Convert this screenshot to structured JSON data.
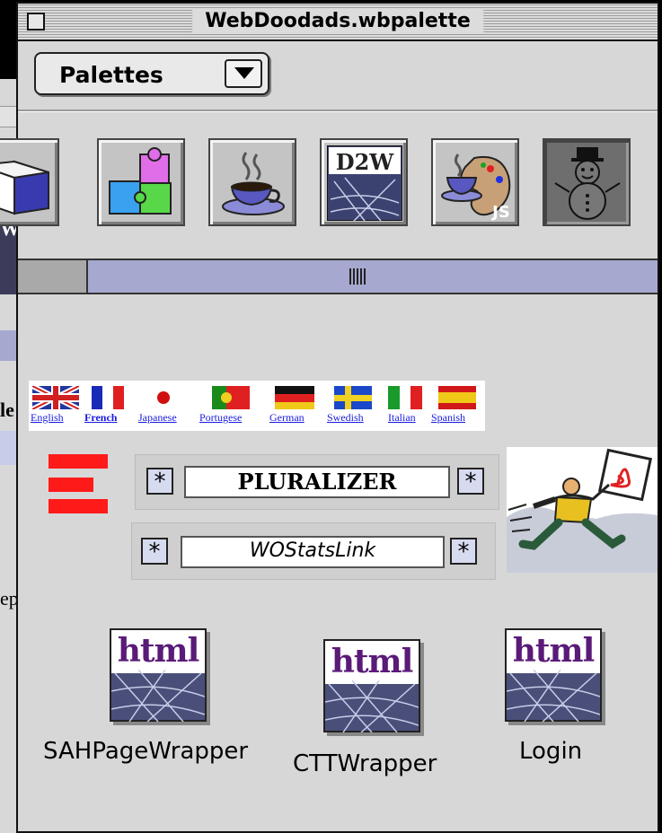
{
  "window": {
    "title": "WebDoodads.wbpalette"
  },
  "palette_selector": {
    "selected": "Palettes"
  },
  "toolbar_icons": [
    {
      "icon": "cube-icon"
    },
    {
      "icon": "puzzle-icon"
    },
    {
      "icon": "coffee-cup-icon"
    },
    {
      "icon": "d2w-icon",
      "label": "D2W"
    },
    {
      "icon": "javascript-palette-icon",
      "label": "JS"
    },
    {
      "icon": "snowman-icon"
    }
  ],
  "languages": [
    "English",
    "French",
    "Japanese",
    "Portugese",
    "German",
    "Swedish",
    "Italian",
    "Spanish"
  ],
  "steppers": {
    "pluralizer": {
      "value": "PLURALIZER",
      "button": "*"
    },
    "wostats": {
      "value": "WOStatsLink",
      "button": "*"
    }
  },
  "components": [
    {
      "icon_text": "html",
      "label": "SAHPageWrapper"
    },
    {
      "icon_text": "html",
      "label": "CTTWrapper"
    },
    {
      "icon_text": "html",
      "label": "Login"
    }
  ],
  "background_window": {
    "letters": [
      "W",
      "le",
      "ep"
    ]
  }
}
